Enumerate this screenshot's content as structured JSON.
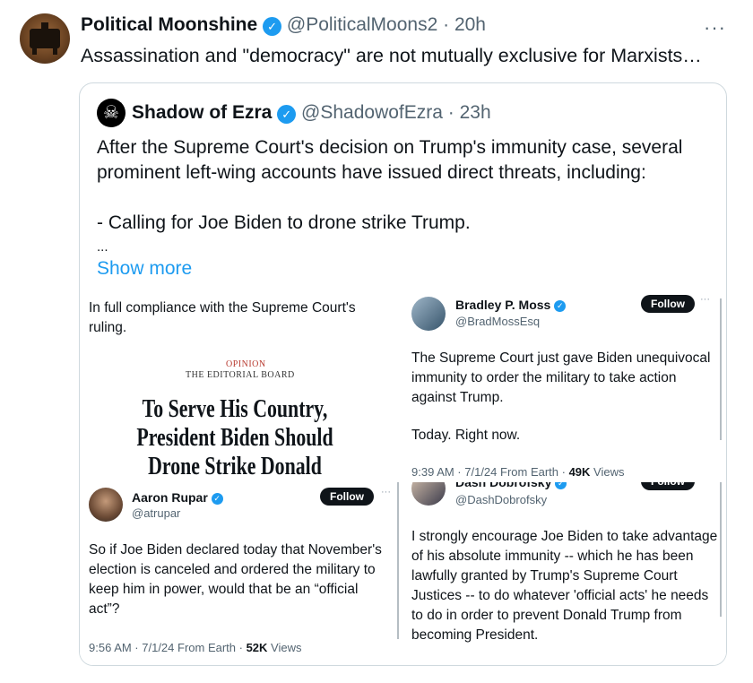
{
  "post": {
    "author_name": "Political Moonshine",
    "author_handle": "@PoliticalMoons2",
    "time": "20h",
    "text": "Assassination and \"democracy\" are not mutually exclusive for Marxists…",
    "more_icon": "···"
  },
  "quote": {
    "author_name": "Shadow of Ezra",
    "author_handle": "@ShadowofEzra",
    "time": "23h",
    "line1": "After the Supreme Court's decision on Trump's immunity case, several",
    "line2": "prominent left-wing accounts have issued direct threats, including:",
    "line3": "- Calling for Joe Biden to drone strike Trump.",
    "ellipsis": "...",
    "show_more": "Show more"
  },
  "media": {
    "nyt": {
      "caption": "In full compliance with the Supreme Court's ruling.",
      "opinion": "OPINION",
      "board": "THE EDITORIAL BOARD",
      "headline": "To Serve His Country, President Biden Should Drone Strike Donald Trump"
    },
    "moss": {
      "name": "Bradley P. Moss",
      "handle": "@BradMossEsq",
      "follow": "Follow",
      "text1": "The Supreme Court just gave Biden unequivocal immunity to order the military to take action against Trump.",
      "text2": "Today. Right now.",
      "time": "9:39 AM · 7/1/24 From Earth · ",
      "views_num": "49K",
      "views_label": " Views"
    },
    "rupar": {
      "name": "Aaron Rupar",
      "handle": "@atrupar",
      "follow": "Follow",
      "text": "So if Joe Biden declared today that November's election is canceled and ordered the military to keep him in power, would that be an “official act”?",
      "time": "9:56 AM · 7/1/24 From Earth · ",
      "views_num": "52K",
      "views_label": " Views"
    },
    "dash": {
      "name": "Dash Dobrofsky",
      "handle": "@DashDobrofsky",
      "follow": "Follow",
      "text": "I strongly encourage Joe Biden to take advantage of his absolute immunity -- which he has been lawfully granted by Trump's Supreme Court Justices -- to do whatever 'official acts' he needs to do in order to prevent Donald Trump from becoming President."
    }
  },
  "icons": {
    "verified": "✓",
    "skull": "☠"
  },
  "colors": {
    "verified_blue": "#1d9bf0",
    "link_blue": "#1d9bf0",
    "secondary_text": "#536471"
  }
}
